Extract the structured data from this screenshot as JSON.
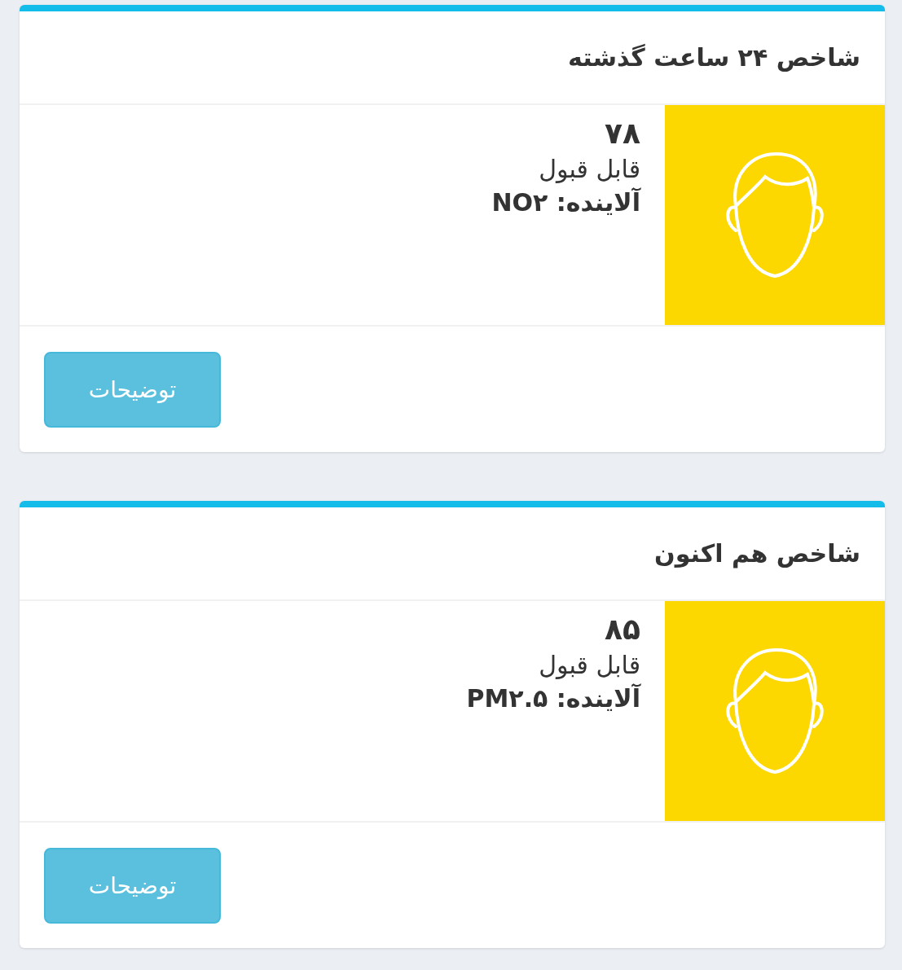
{
  "cards": [
    {
      "title": "شاخص ۲۴ ساعت گذشته",
      "value": "۷۸",
      "status": "قابل قبول",
      "pollutant": "آلاینده: NO۲",
      "button": "توضیحات"
    },
    {
      "title": "شاخص هم اکنون",
      "value": "۸۵",
      "status": "قابل قبول",
      "pollutant": "آلاینده: PM۲.۵",
      "button": "توضیحات"
    }
  ]
}
